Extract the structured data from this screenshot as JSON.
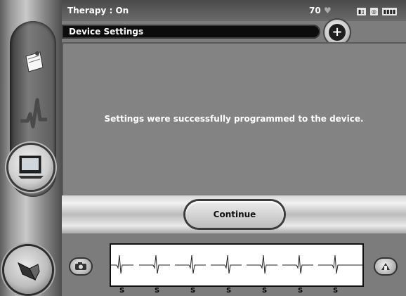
{
  "status": {
    "therapy_text": "Therapy : On",
    "heart_rate": "70",
    "icons": [
      "heart-icon",
      "battery-icon",
      "telemetry-icon",
      "signal-icon"
    ]
  },
  "header": {
    "title": "Device Settings"
  },
  "main": {
    "message": "Settings were successfully programmed to the device."
  },
  "actions": {
    "continue_label": "Continue"
  },
  "ecg": {
    "markers": [
      "S",
      "S",
      "S",
      "S",
      "S",
      "S",
      "S"
    ]
  },
  "sidebar": {
    "items": [
      "notes-icon",
      "ecg-tool-icon",
      "monitor-icon",
      "wand-icon"
    ]
  },
  "colors": {
    "screen_bg": "#7d7d7d",
    "title_bar": "#0c0c0c",
    "text": "#ffffff"
  }
}
